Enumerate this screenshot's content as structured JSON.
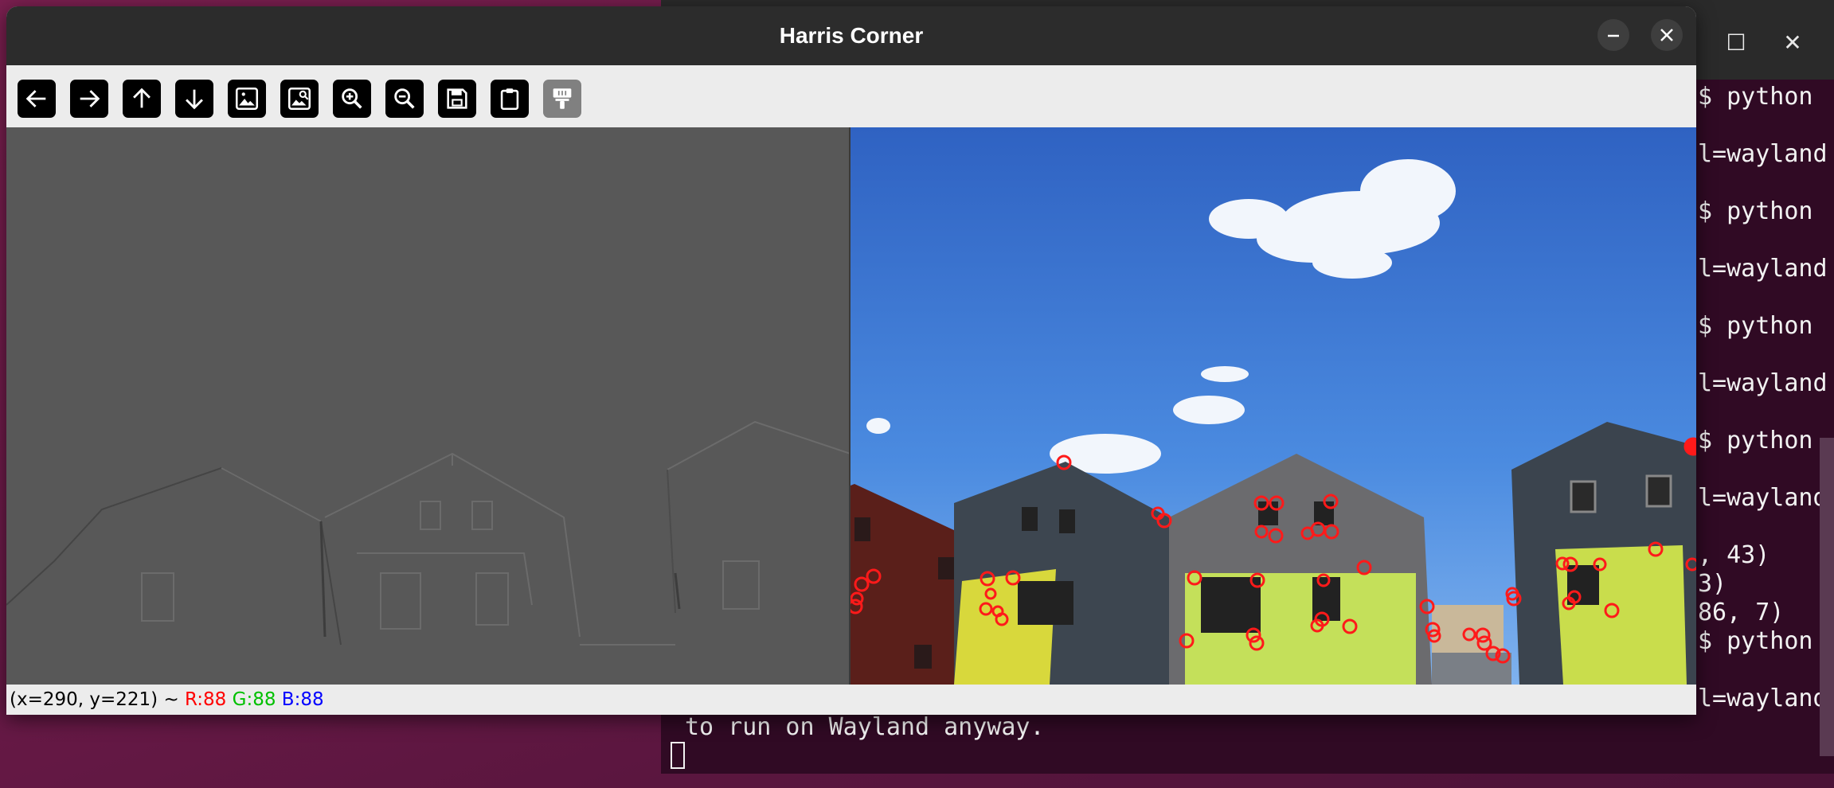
{
  "window": {
    "title": "Harris Corner"
  },
  "toolbar": {
    "buttons": [
      {
        "name": "pan-left",
        "icon": "arrow-left-icon"
      },
      {
        "name": "pan-right",
        "icon": "arrow-right-icon"
      },
      {
        "name": "pan-up",
        "icon": "arrow-up-icon"
      },
      {
        "name": "pan-down",
        "icon": "arrow-down-icon"
      },
      {
        "name": "zoom-original",
        "icon": "image-icon"
      },
      {
        "name": "zoom-fit",
        "icon": "image-search-icon"
      },
      {
        "name": "zoom-in",
        "icon": "zoom-in-icon"
      },
      {
        "name": "zoom-out",
        "icon": "zoom-out-icon"
      },
      {
        "name": "save-image",
        "icon": "save-icon"
      },
      {
        "name": "copy-clipboard",
        "icon": "clipboard-icon"
      },
      {
        "name": "properties",
        "icon": "paint-brush-icon"
      }
    ]
  },
  "status": {
    "coord": "(x=290, y=221) ~",
    "r": "R:88",
    "g": "G:88",
    "b": "B:88"
  },
  "terminal": {
    "lines": [
      "$ python",
      "l=wayland",
      "$ python",
      "l=wayland",
      "$ python",
      "l=wayland",
      "$ python",
      "l=wayland",
      ", 43)",
      "3)",
      "86, 7)",
      "$ python",
      "l=wayland"
    ],
    "bottom_line": "to run on Wayland anyway.",
    "controls": {
      "maximize": "☐",
      "close": "✕"
    }
  },
  "colors": {
    "marker": "#ff1a1a",
    "sky": "#3c78d8",
    "titlebar": "#2c2c2c"
  }
}
